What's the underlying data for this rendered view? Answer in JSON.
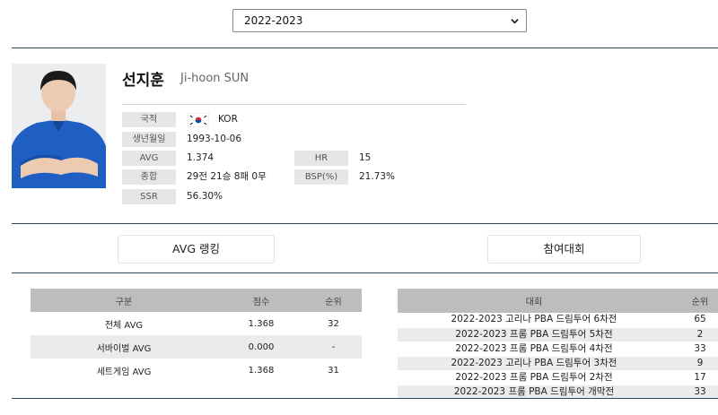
{
  "season_select": {
    "value": "2022-2023"
  },
  "player": {
    "name_ko": "선지훈",
    "name_en": "Ji-hoon SUN"
  },
  "profile": {
    "nationality_label": "국적",
    "nationality_value": "KOR",
    "birth_label": "생년월일",
    "birth_value": "1993-10-06",
    "avg_label": "AVG",
    "avg_value": "1.374",
    "hr_label": "HR",
    "hr_value": "15",
    "total_label": "종합",
    "total_value": "29전 21승 8패 0무",
    "bsp_label": "BSP(%)",
    "bsp_value": "21.73%",
    "ssr_label": "SSR",
    "ssr_value": "56.30%"
  },
  "sections": {
    "avg_ranking": "AVG 랭킹",
    "competitions": "참여대회"
  },
  "avg_table": {
    "headers": [
      "구분",
      "점수",
      "순위"
    ],
    "rows": [
      [
        "전체 AVG",
        "1.368",
        "32"
      ],
      [
        "서바이벌 AVG",
        "0.000",
        "-"
      ],
      [
        "세트게임 AVG",
        "1.368",
        "31"
      ]
    ]
  },
  "comp_table": {
    "headers": [
      "대회",
      "순위"
    ],
    "rows": [
      [
        "2022-2023 고리나 PBA 드림투어 6차전",
        "65"
      ],
      [
        "2022-2023 프롬 PBA 드림투어 5차전",
        "2"
      ],
      [
        "2022-2023 프롬 PBA 드림투어 4차전",
        "33"
      ],
      [
        "2022-2023 고리나 PBA 드림투어 3차전",
        "9"
      ],
      [
        "2022-2023 프롬 PBA 드림투어 2차전",
        "17"
      ],
      [
        "2022-2023 프롬 PBA 드림투어 개막전",
        "33"
      ]
    ]
  },
  "colors": {
    "rule": "#2e4a5a",
    "header_bg": "#bdbdbd",
    "label_bg": "#e6e6e6",
    "jersey": "#1f5fc4"
  }
}
